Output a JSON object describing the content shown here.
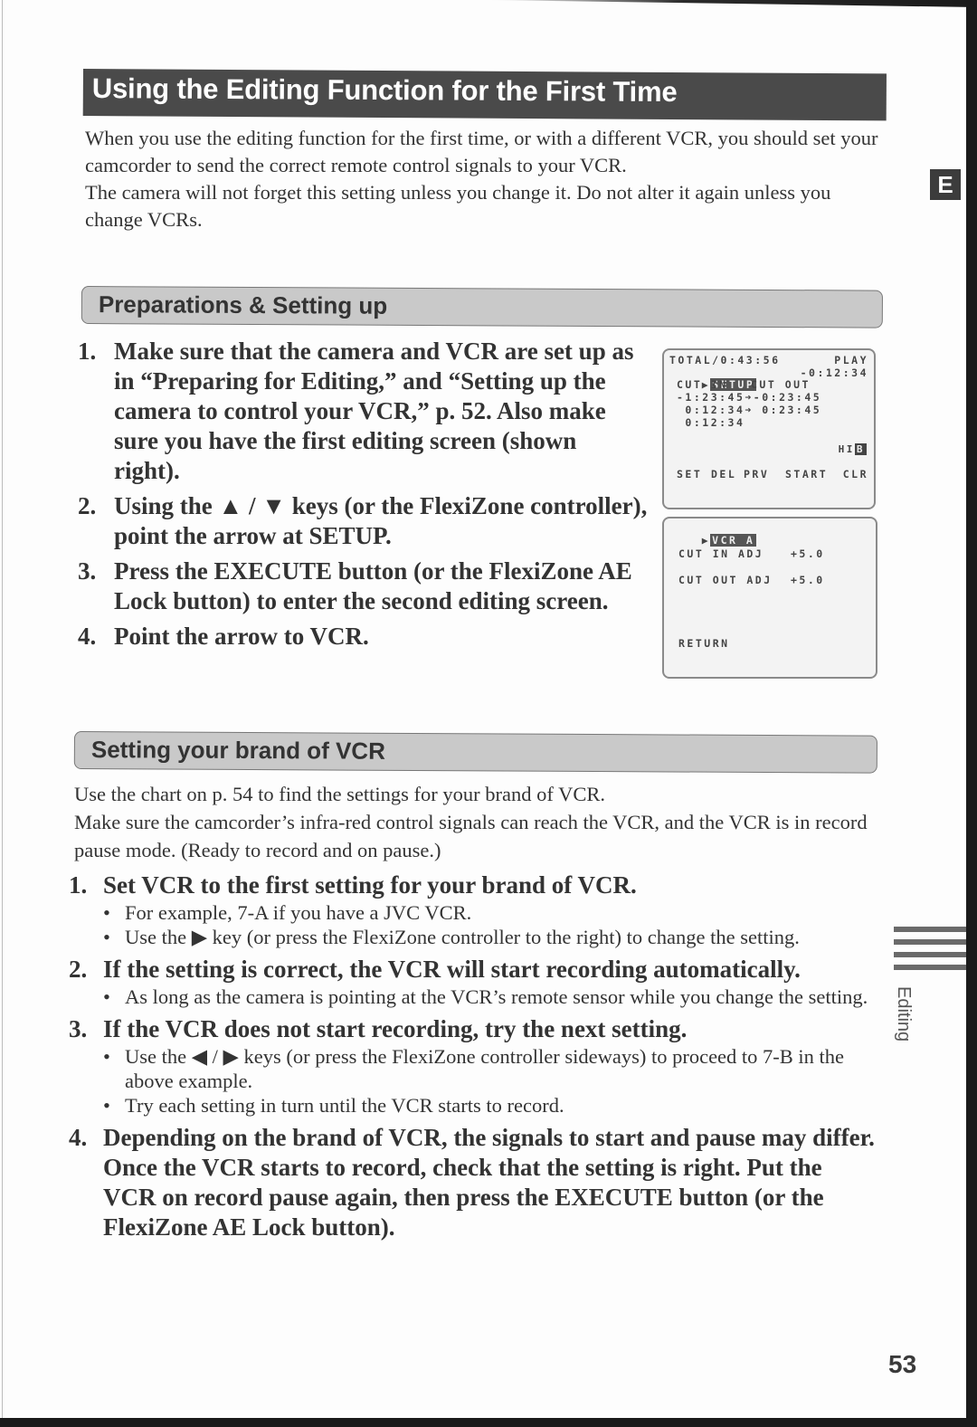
{
  "title": "Using the Editing Function for the First Time",
  "intro": [
    "When you use the editing function for the first time, or with a different VCR, you should set your camcorder to send the correct remote control signals to your VCR.",
    "The camera will not forget this setting unless you change it. Do not alter it again unless you change VCRs."
  ],
  "side_tab": "E",
  "side_label": "Editing",
  "page_number": "53",
  "preparations": {
    "heading": "Preparations & Setting up",
    "steps": [
      {
        "num": "1.",
        "text": "Make sure that the camera and VCR are set up as in “Preparing for Editing,” and “Setting up the camera to control your VCR,” p. 52. Also make sure you have the first editing screen (shown right)."
      },
      {
        "num": "2.",
        "text": "Using the ▲ / ▼ keys (or the FlexiZone controller), point the arrow at SETUP."
      },
      {
        "num": "3.",
        "text": "Press the EXECUTE button (or the FlexiZone AE Lock button) to enter the second editing screen."
      },
      {
        "num": "4.",
        "text": "Point the arrow to VCR."
      }
    ]
  },
  "screen1": {
    "total": "TOTAL/0:43:56",
    "mode": "PLAY",
    "pointer": "▶",
    "selected": "SETUP",
    "counter": "-0:12:34",
    "col_in": "CUT IN",
    "col_out": "CUT OUT",
    "rows": [
      "-1:23:45➜-0:23:45",
      " 0:12:34➜ 0:23:45",
      " 0:12:34"
    ],
    "badge_a": "HI",
    "badge_b": "B",
    "menu": [
      "SET",
      "DEL",
      "PRV",
      "START",
      "CLR"
    ]
  },
  "screen2": {
    "pointer": "▶",
    "selected": "VCR A",
    "cut_in_label": "CUT IN ADJ",
    "cut_in_value": "+5.0",
    "cut_out_label": "CUT OUT ADJ",
    "cut_out_value": "+5.0",
    "return": "RETURN"
  },
  "brand": {
    "heading": "Setting your brand of VCR",
    "intro": [
      "Use the chart on p. 54 to find the settings for your brand of VCR.",
      "Make sure the camcorder’s infra-red control signals can reach the VCR, and the VCR is in record pause mode. (Ready to record and on pause.)"
    ],
    "steps": [
      {
        "num": "1.",
        "text": "Set VCR to the first setting for your brand of VCR.",
        "bullets": [
          "For example, 7-A if you have a JVC VCR.",
          "Use the ▶ key (or press the FlexiZone controller to the right) to change the setting."
        ]
      },
      {
        "num": "2.",
        "text": "If the setting is correct, the VCR will start recording automatically.",
        "bullets": [
          "As long as the camera is pointing at the VCR’s remote sensor while you change the setting."
        ]
      },
      {
        "num": "3.",
        "text": "If the VCR does not start recording, try the next setting.",
        "bullets": [
          "Use the ◀ / ▶ keys (or press the FlexiZone controller sideways) to proceed to 7-B in the above example.",
          "Try each setting in turn until the VCR starts to record."
        ]
      },
      {
        "num": "4.",
        "text": "Depending on the brand of VCR, the signals to start and pause may differ. Once the VCR starts to record, check that the setting is right. Put the VCR on record pause again, then press the EXECUTE button (or the FlexiZone AE Lock button).",
        "bullets": []
      }
    ]
  }
}
